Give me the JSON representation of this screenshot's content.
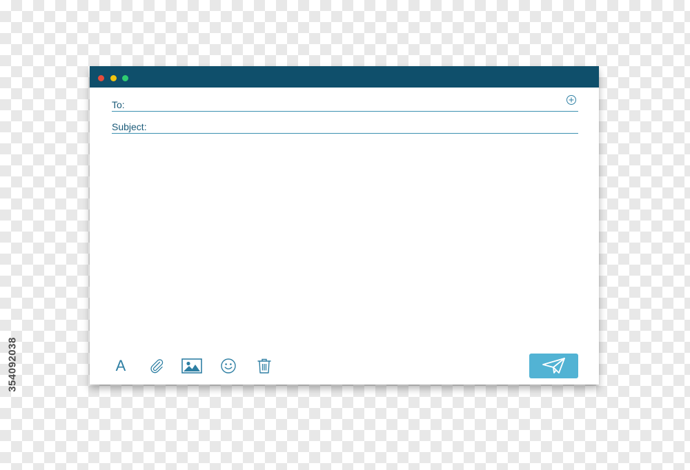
{
  "window": {
    "controls": {
      "close": "#e74c3c",
      "minimize": "#f1c40f",
      "maximize": "#2ecc71"
    },
    "titlebar_color": "#0f4f6b"
  },
  "compose": {
    "to_label": "To:",
    "to_value": "",
    "subject_label": "Subject:",
    "subject_value": "",
    "body_value": "",
    "add_recipient_icon": "plus-circle-icon"
  },
  "toolbar": {
    "format_glyph": "A",
    "icons": [
      "font-format-icon",
      "paperclip-icon",
      "image-icon",
      "emoji-icon",
      "trash-icon"
    ],
    "send_icon": "paper-plane-icon",
    "accent_color": "#2e7fa3",
    "send_color": "#52b3d4"
  },
  "stock_id": "354092038"
}
